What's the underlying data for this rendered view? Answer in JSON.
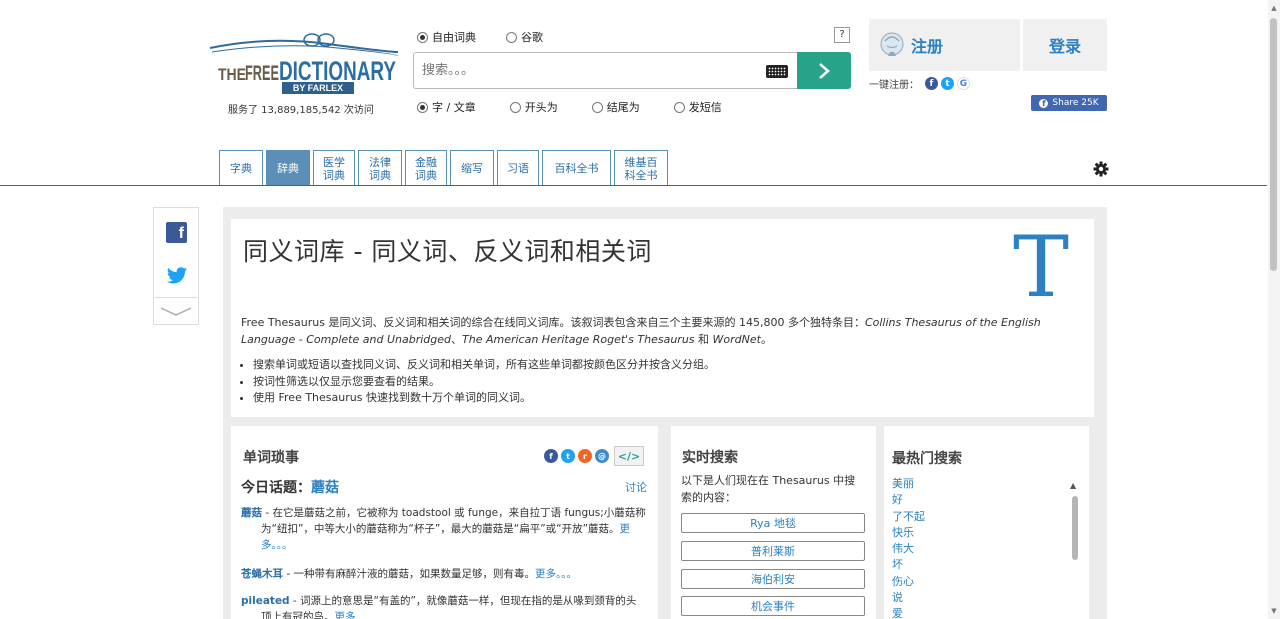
{
  "header": {
    "visits": "服务了 13,889,185,542 次访问",
    "source_options": [
      {
        "label": "自由词典",
        "selected": true
      },
      {
        "label": "谷歌",
        "selected": false
      }
    ],
    "help_label": "?",
    "search": {
      "placeholder": "搜索。。。",
      "value": ""
    },
    "mode_options": [
      {
        "label": "字 / 文章",
        "selected": true
      },
      {
        "label": "开头为",
        "selected": false
      },
      {
        "label": "结尾为",
        "selected": false
      },
      {
        "label": "发短信",
        "selected": false
      }
    ],
    "register_label": "注册",
    "login_label": "登录",
    "one_click_label": "一键注册：",
    "share_label": "Share 25K"
  },
  "tabs": [
    {
      "label": "字典",
      "active": false
    },
    {
      "label": "辞典",
      "active": true
    },
    {
      "label": "医学\n词典",
      "active": false
    },
    {
      "label": "法律\n词典",
      "active": false
    },
    {
      "label": "金融\n词典",
      "active": false
    },
    {
      "label": "缩写",
      "active": false
    },
    {
      "label": "习语",
      "active": false
    },
    {
      "label": "百科全书",
      "active": false
    },
    {
      "label": "维基百\n科全书",
      "active": false
    }
  ],
  "intro": {
    "title": "同义词库 - 同义词、反义词和相关词",
    "big_letter": "T",
    "desc_plain": "Free Thesaurus 是同义词、反义词和相关词的综合在线同义词库。该叙词表包含来自三个主要来源的 145,800 多个独特条目：",
    "desc_source1": "Collins Thesaurus of the English Language - Complete and Unabridged",
    "desc_sep1": "、",
    "desc_source2": "The American Heritage Roget's Thesaurus",
    "desc_and": " 和 ",
    "desc_source3": "WordNet",
    "desc_end": "。",
    "bullets": [
      "搜索单词或短语以查找同义词、反义词和相关单词，所有这些单词都按颜色区分并按含义分组。",
      "按词性筛选以仅显示您要查看的结果。",
      "使用 Free Thesaurus 快速找到数十万个单词的同义词。"
    ]
  },
  "word_trivia": {
    "heading": "单词琐事",
    "embed_label": "</>",
    "topic_label": "今日话题：",
    "topic_word": "蘑菇",
    "discuss_label": "讨论",
    "entries": [
      {
        "term": "蘑菇",
        "text": " - 在它是蘑菇之前，它被称为 toadstool 或 funge，来自拉丁语 fungus;小蘑菇称为“纽扣”，中等大小的蘑菇称为“杯子”，最大的蘑菇是“扁平”或“开放”蘑菇。",
        "more": "更多。。。"
      },
      {
        "term": "苍蝇木耳",
        "text": " - 一种带有麻醉汁液的蘑菇，如果数量足够，则有毒。",
        "more": "更多。。。"
      },
      {
        "term": "pileated",
        "text": " - 词源上的意思是“有盖的”，就像蘑菇一样，但现在指的是从喙到颈背的头顶上有冠的鸟。",
        "more": "更多"
      }
    ]
  },
  "live_search": {
    "heading": "实时搜索",
    "subtitle": "以下是人们现在在 Thesaurus 中搜索的内容：",
    "items": [
      "Rya 地毯",
      "普利莱斯",
      "海伯利安",
      "机会事件"
    ]
  },
  "top_searches": {
    "heading": "最热门搜索",
    "items": [
      "美丽",
      "好",
      "了不起",
      "快乐",
      "伟大",
      "坏",
      "伤心",
      "说",
      "爱"
    ]
  },
  "colors": {
    "accent_blue": "#2b81c2",
    "search_green": "#27a389",
    "tab_active": "#5b8fb8"
  }
}
